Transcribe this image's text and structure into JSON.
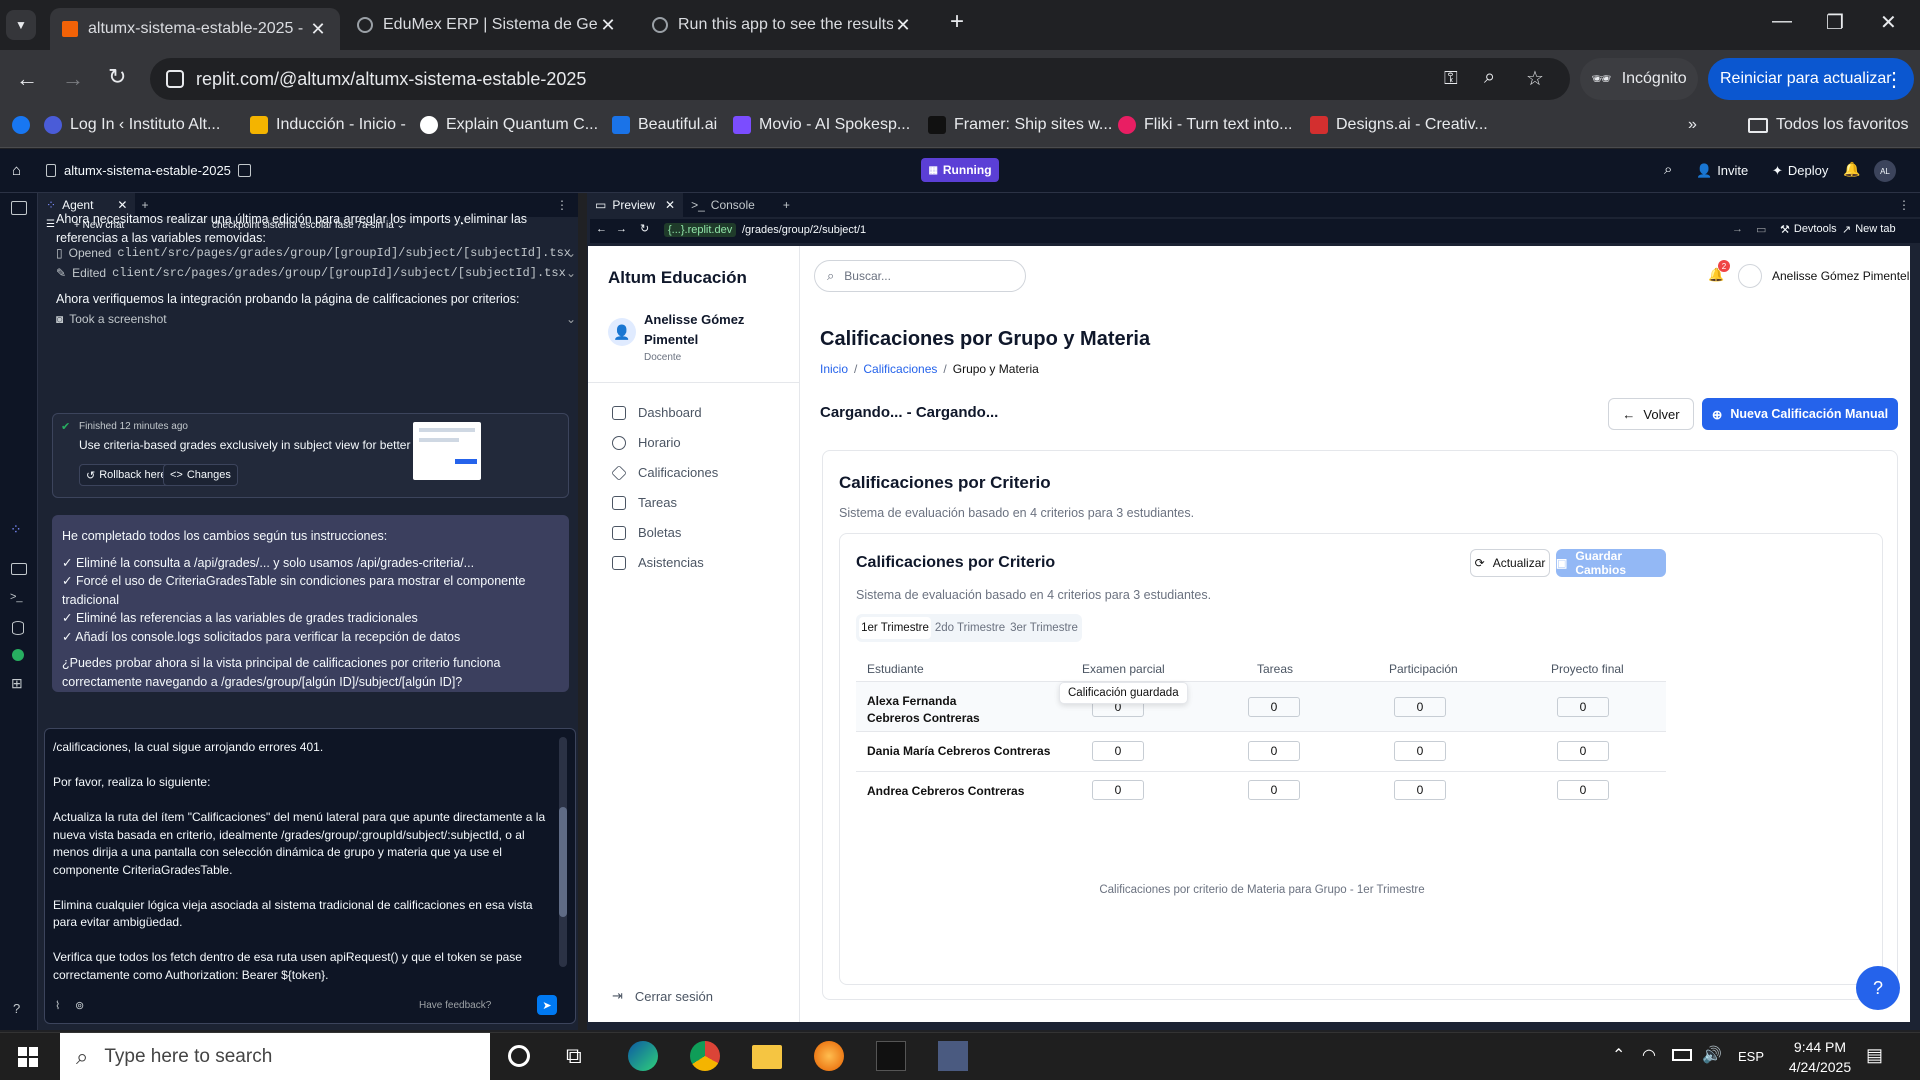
{
  "browser": {
    "tabs": [
      {
        "title": "altumx-sistema-estable-2025 - ",
        "active": true
      },
      {
        "title": "EduMex ERP | Sistema de Gestión",
        "active": false
      },
      {
        "title": "Run this app to see the results h",
        "active": false
      }
    ],
    "url": "replit.com/@altumx/altumx-sistema-estable-2025",
    "incognito": "Incógnito",
    "restart": "Reiniciar para actualizar",
    "bookmarks": [
      "Log In ‹ Instituto Alt...",
      "Inducción - Inicio -",
      "Explain Quantum C...",
      "Beautiful.ai",
      "Movio - AI Spokesp...",
      "Framer: Ship sites w...",
      "Fliki - Turn text into...",
      "Designs.ai - Creativ..."
    ],
    "all_bookmarks": "Todos los favoritos"
  },
  "replit": {
    "repl_name": "altumx-sistema-estable-2025",
    "status": "Running",
    "invite": "Invite",
    "deploy": "Deploy",
    "avatar": "AL",
    "agent_tab": "Agent",
    "new_chat": "New chat",
    "checkpoint_title": "checkpoint sistema escolar fase 7a sin ia",
    "agent_intro": "Ahora necesitamos realizar una última edición para arreglar los imports y eliminar las referencias a las variables removidas:",
    "step1_label": "Opened",
    "step1_path": "client/src/pages/grades/group/[groupId]/subject/[subjectId].tsx",
    "step2_label": "Edited",
    "step2_path": "client/src/pages/grades/group/[groupId]/subject/[subjectId].tsx",
    "verify_text": "Ahora verifiquemos la integración probando la página de calificaciones por criterios:",
    "screenshot_step": "Took a screenshot",
    "finished": "Finished 12 minutes ago",
    "checkpoint_msg": "Use criteria-based grades exclusively in subject view for better clarity",
    "rollback": "Rollback here",
    "changes": "Changes",
    "msg_intro": "He completado todos los cambios según tus instrucciones:",
    "msg_items": [
      "✓ Eliminé la consulta a /api/grades/... y solo usamos /api/grades-criteria/...",
      "✓ Forcé el uso de CriteriaGradesTable sin condiciones para mostrar el componente tradicional",
      "✓ Eliminé las referencias a las variables de grades tradicionales",
      "✓ Añadí los console.logs solicitados para verificar la recepción de datos"
    ],
    "msg_question": "¿Puedes probar ahora si la vista principal de calificaciones por criterio funciona correctamente navegando a /grades/group/[algún ID]/subject/[algún ID]?",
    "input_text": "/calificaciones, la cual sigue arrojando errores 401.\n\nPor favor, realiza lo siguiente:\n\nActualiza la ruta del ítem \"Calificaciones\" del menú lateral para que apunte directamente a la nueva vista basada en criterio, idealmente /grades/group/:groupId/subject/:subjectId, o al menos dirija a una pantalla con selección dinámica de grupo y materia que ya use el componente CriteriaGradesTable.\n\nElimina cualquier lógica vieja asociada al sistema tradicional de calificaciones en esa vista para evitar ambigüedad.\n\nVerifica que todos los fetch dentro de esa ruta usen apiRequest() y que el token se pase correctamente como Authorization: Bearer ${token}.",
    "feedback": "Have feedback?",
    "preview_tab": "Preview",
    "console_tab": "Console",
    "preview_host": "{...}.replit.dev",
    "preview_path": "/grades/group/2/subject/1",
    "devtools": "Devtools",
    "new_tab": "New tab"
  },
  "app": {
    "brand": "Altum Educación",
    "user_name": "Anelisse Gómez Pimentel",
    "user_role": "Docente",
    "nav": [
      "Dashboard",
      "Horario",
      "Calificaciones",
      "Tareas",
      "Boletas",
      "Asistencias"
    ],
    "logout": "Cerrar sesión",
    "search_placeholder": "Buscar...",
    "notif_count": "2",
    "header_user": "Anelisse Gómez Pimentel",
    "page_title": "Calificaciones por Grupo y Materia",
    "breadcrumb": [
      "Inicio",
      "Calificaciones",
      "Grupo y Materia"
    ],
    "loading": "Cargando... - Cargando...",
    "back": "Volver",
    "new_grade": "Nueva Calificación Manual",
    "outer_title": "Calificaciones por Criterio",
    "outer_sub": "Sistema de evaluación basado en 4 criterios para 3 estudiantes.",
    "inner_title": "Calificaciones por Criterio",
    "inner_sub": "Sistema de evaluación basado en 4 criterios para 3 estudiantes.",
    "refresh": "Actualizar",
    "save": "Guardar Cambios",
    "terms": [
      "1er Trimestre",
      "2do Trimestre",
      "3er Trimestre"
    ],
    "columns": [
      "Estudiante",
      "Examen parcial",
      "Tareas",
      "Participación",
      "Proyecto final"
    ],
    "rows": [
      {
        "name": "Alexa Fernanda Cebreros Contreras",
        "values": [
          "0",
          "0",
          "0",
          "0"
        ]
      },
      {
        "name": "Dania María Cebreros Contreras",
        "values": [
          "0",
          "0",
          "0",
          "0"
        ]
      },
      {
        "name": "Andrea Cebreros Contreras",
        "values": [
          "0",
          "0",
          "0",
          "0"
        ]
      }
    ],
    "tooltip": "Calificación guardada",
    "caption": "Calificaciones por criterio de Materia para Grupo - 1er Trimestre"
  },
  "taskbar": {
    "search": "Type here to search",
    "time": "9:44 PM",
    "date": "4/24/2025",
    "lang": "ESP"
  }
}
